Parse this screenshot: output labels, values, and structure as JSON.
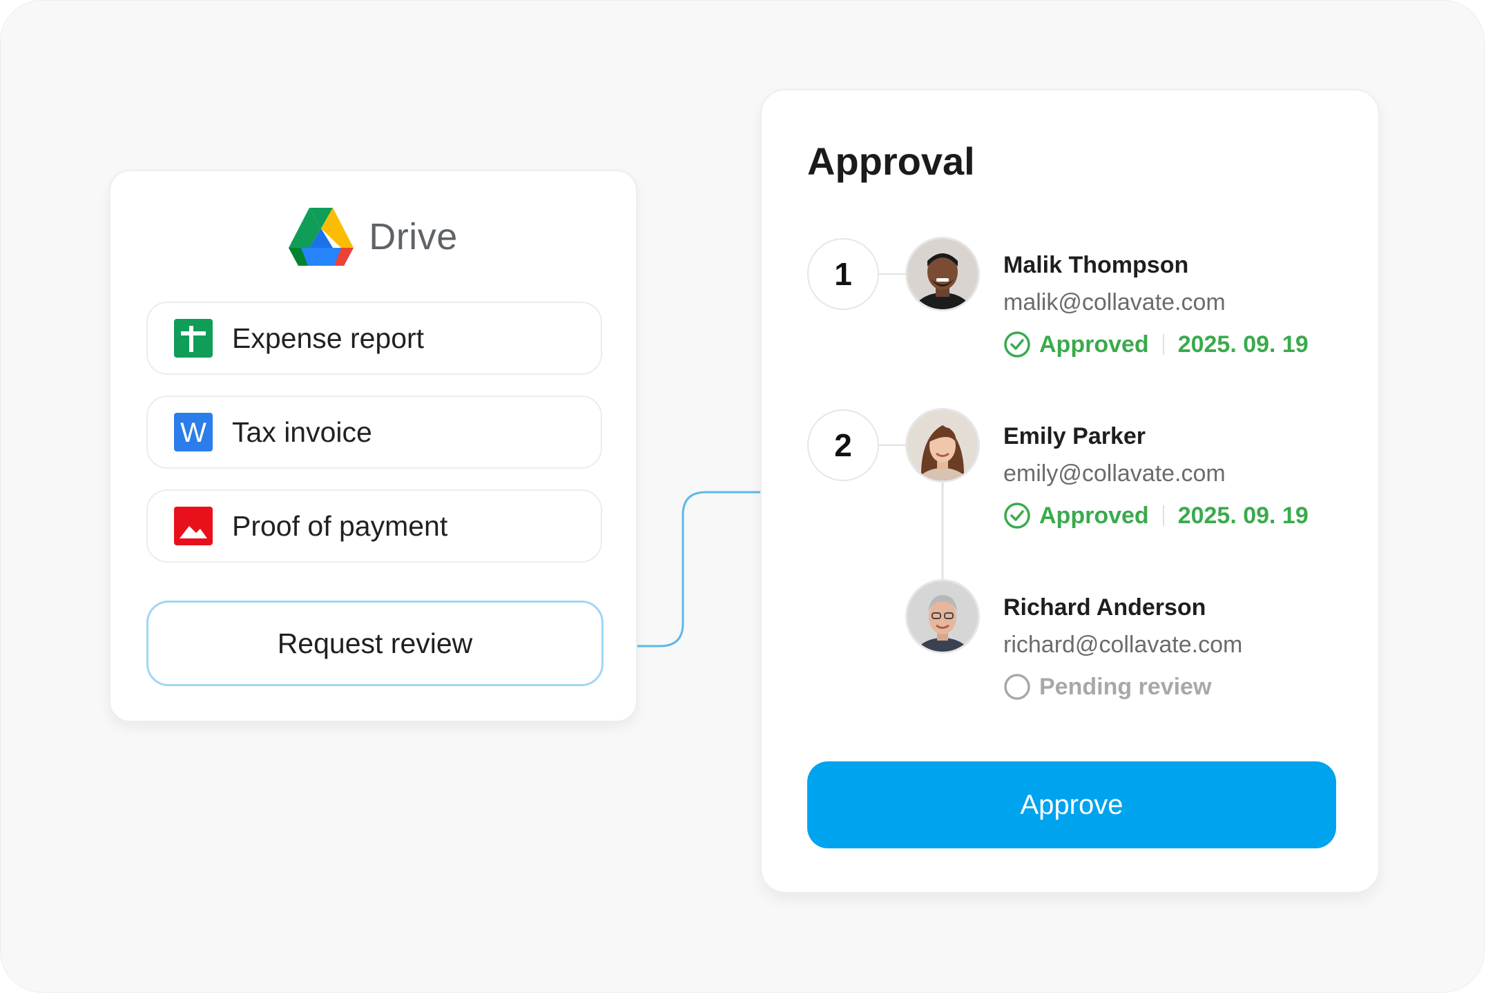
{
  "drive": {
    "title": "Drive",
    "files": [
      {
        "label": "Expense report",
        "icon": "sheets-icon",
        "color": "#0f9d58"
      },
      {
        "label": "Tax invoice",
        "icon": "word-icon",
        "color": "#2b7de9"
      },
      {
        "label": "Proof of payment",
        "icon": "image-icon",
        "color": "#e8101a"
      }
    ],
    "request_button": "Request review"
  },
  "approval": {
    "title": "Approval",
    "steps": [
      {
        "number": "1"
      },
      {
        "number": "2"
      }
    ],
    "approvers": [
      {
        "name": "Malik Thompson",
        "email": "malik@collavate.com",
        "status": "Approved",
        "date": "2025. 09. 19"
      },
      {
        "name": "Emily Parker",
        "email": "emily@collavate.com",
        "status": "Approved",
        "date": "2025. 09. 19"
      },
      {
        "name": "Richard Anderson",
        "email": "richard@collavate.com",
        "status": "Pending review"
      }
    ],
    "approve_button": "Approve"
  },
  "colors": {
    "accent": "#00a3ee",
    "approved": "#3aaa4c",
    "pending": "#a8a8a8",
    "connector": "#5bb8ea"
  }
}
